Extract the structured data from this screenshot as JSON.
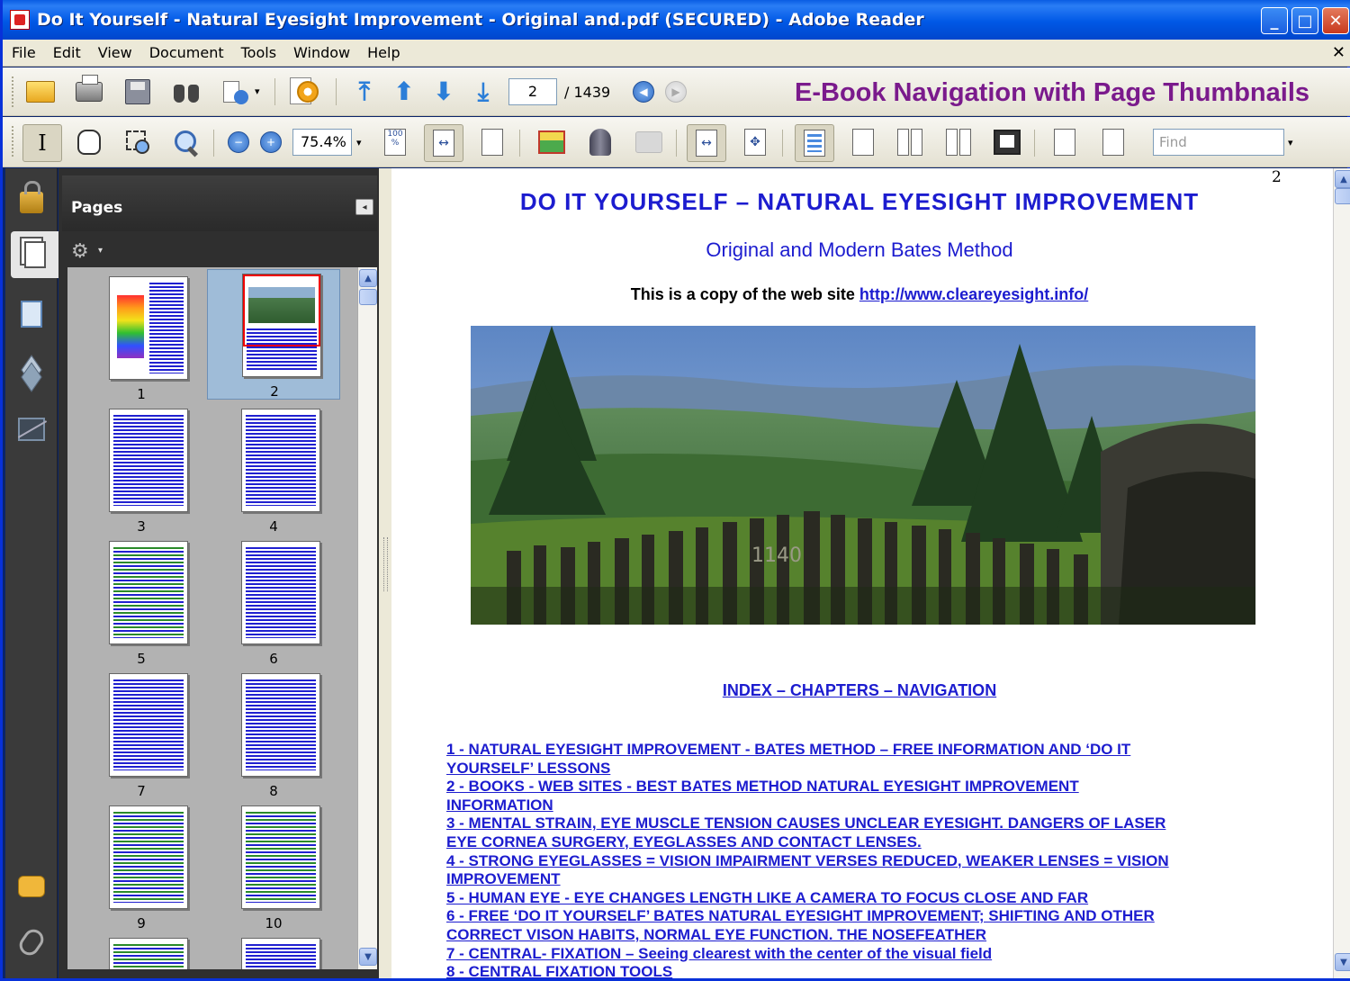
{
  "window": {
    "title": "Do It Yourself - Natural Eyesight Improvement - Original and.pdf (SECURED) - Adobe Reader",
    "minimize": "_",
    "maximize": "□",
    "close": "✕"
  },
  "menu": {
    "items": [
      "File",
      "Edit",
      "View",
      "Document",
      "Tools",
      "Window",
      "Help"
    ],
    "close": "✕"
  },
  "toolbar1": {
    "current_page": "2",
    "total_pages": "/ 1439",
    "banner": "E-Book Navigation with Page Thumbnails",
    "icons": {
      "open": "folder-icon",
      "print": "printer-icon",
      "save": "save-icon",
      "find": "binoculars-icon",
      "collaborate": "people-icon",
      "security": "gear-document-icon",
      "first_page": "first-page-icon",
      "prev_page": "up-arrow-icon",
      "next_page": "down-arrow-icon",
      "last_page": "last-page-icon",
      "prev_view": "back-icon",
      "next_view": "forward-icon"
    }
  },
  "toolbar2": {
    "zoom": "75.4%",
    "find_placeholder": "Find",
    "actual_size_label": "100 %",
    "first_page_glyph": "⤒",
    "prev_glyph": "⬆",
    "next_glyph": "⬇",
    "last_page_glyph": "⤓",
    "back_glyph": "◀",
    "forward_glyph": "▶",
    "zoom_out_glyph": "−",
    "zoom_in_glyph": "+",
    "select_glyph": "I",
    "fit_width_glyph": "↔",
    "fit_glyph": "✥",
    "dropdown_glyph": "▾"
  },
  "panel": {
    "title": "Pages",
    "collapse_glyph": "◂",
    "options_glyph": "⚙",
    "options_dd": "▾",
    "thumbnails": [
      {
        "label": "1",
        "style": "rainbow"
      },
      {
        "label": "2",
        "style": "landscape",
        "selected": true
      },
      {
        "label": "3",
        "style": "text"
      },
      {
        "label": "4",
        "style": "text"
      },
      {
        "label": "5",
        "style": "green"
      },
      {
        "label": "6",
        "style": "text"
      },
      {
        "label": "7",
        "style": "text"
      },
      {
        "label": "8",
        "style": "text"
      },
      {
        "label": "9",
        "style": "green"
      },
      {
        "label": "10",
        "style": "green"
      }
    ],
    "scroll_up": "▲",
    "scroll_down": "▼"
  },
  "document": {
    "corner_page_number": "2",
    "title": "DO IT YOURSELF – NATURAL EYESIGHT IMPROVEMENT",
    "subtitle": "Original and Modern Bates Method",
    "copy_text": "This is a copy of the web site ",
    "copy_link": "http://www.cleareyesight.info/",
    "photo_sign": "1140",
    "index_heading": "INDEX – CHAPTERS – NAVIGATION ",
    "toc": [
      "1 - NATURAL EYESIGHT IMPROVEMENT - BATES METHOD – FREE INFORMATION AND ‘DO IT",
      "YOURSELF’ LESSONS",
      "2 - BOOKS - WEB SITES - BEST BATES METHOD NATURAL EYESIGHT IMPROVEMENT",
      "INFORMATION",
      "3 - MENTAL STRAIN, EYE MUSCLE TENSION CAUSES UNCLEAR EYESIGHT.  DANGERS OF LASER",
      "EYE CORNEA SURGERY, EYEGLASSES AND CONTACT LENSES.",
      "4 - STRONG EYEGLASSES = VISION IMPAIRMENT VERSES REDUCED, WEAKER LENSES = VISION",
      "IMPROVEMENT",
      "5 - HUMAN EYE - EYE CHANGES LENGTH LIKE A CAMERA TO FOCUS CLOSE AND FAR",
      "6 - FREE ‘DO IT YOURSELF’ BATES NATURAL EYESIGHT IMPROVEMENT; SHIFTING AND OTHER",
      "CORRECT VISON HABITS, NORMAL EYE FUNCTION.  THE NOSEFEATHER",
      "7 - CENTRAL- FIXATION – Seeing clearest with the center of the visual field",
      "8 - CENTRAL FIXATION TOOLS"
    ]
  },
  "doc_scroll": {
    "up": "▲",
    "down": "▼"
  }
}
